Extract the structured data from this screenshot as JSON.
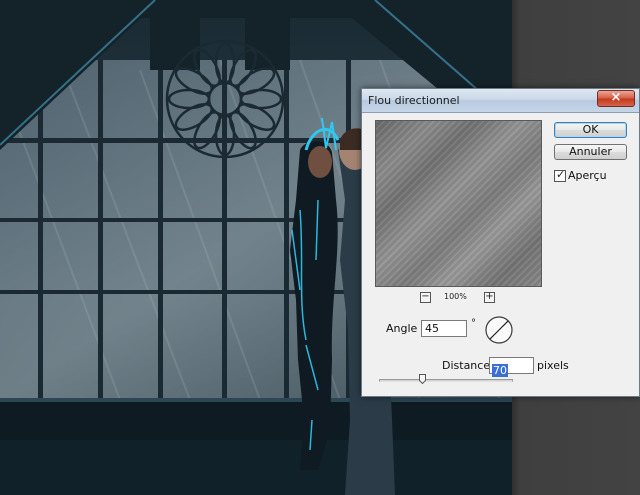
{
  "dialog": {
    "title": "Flou directionnel",
    "close_label": "×",
    "ok_label": "OK",
    "cancel_label": "Annuler",
    "preview_label": "Aperçu",
    "preview_checked": true,
    "zoom_minus": "−",
    "zoom_plus": "+",
    "zoom_level": "100%",
    "angle_label": "Angle :",
    "angle_value": "45",
    "angle_unit": "°",
    "distance_label": "Distance :",
    "distance_value": "70",
    "distance_unit": "pixels"
  },
  "colors": {
    "accent_selection": "#3b6fd8",
    "close_button": "#c43a1f",
    "neon_blue": "#2fc8f0"
  }
}
